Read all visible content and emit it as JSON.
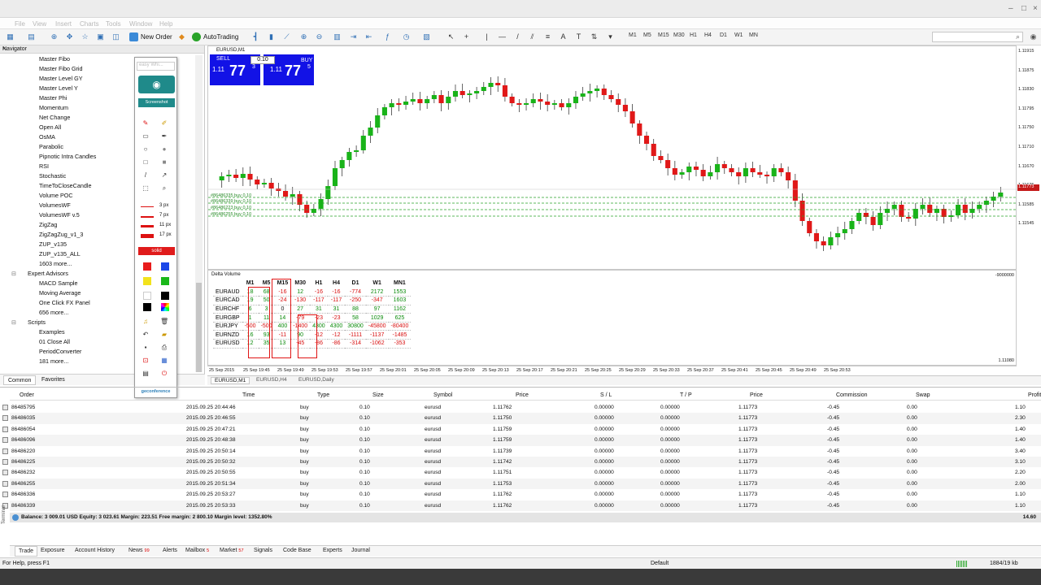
{
  "menu": {
    "items": [
      "File",
      "View",
      "Insert",
      "Charts",
      "Tools",
      "Window",
      "Help"
    ]
  },
  "toolbar": {
    "new_order": "New Order",
    "autotrading": "AutoTrading",
    "timeframes": [
      "M1",
      "M5",
      "M15",
      "M30",
      "H1",
      "H4",
      "D1",
      "W1",
      "MN"
    ]
  },
  "navigator": {
    "title": "Navigator",
    "items": [
      {
        "label": "Master Fibo",
        "indent": 1
      },
      {
        "label": "Master Fibo Grid",
        "indent": 1
      },
      {
        "label": "Master Level GY",
        "indent": 1
      },
      {
        "label": "Master Level Y",
        "indent": 1
      },
      {
        "label": "Master Phi",
        "indent": 1
      },
      {
        "label": "Momentum",
        "indent": 1
      },
      {
        "label": "Net Change",
        "indent": 1
      },
      {
        "label": "Open All",
        "indent": 1
      },
      {
        "label": "OsMA",
        "indent": 1
      },
      {
        "label": "Parabolic",
        "indent": 1
      },
      {
        "label": "Pipnotic Intra Candles",
        "indent": 1
      },
      {
        "label": "RSI",
        "indent": 1
      },
      {
        "label": "Stochastic",
        "indent": 1
      },
      {
        "label": "TimeToCloseCandle",
        "indent": 1
      },
      {
        "label": "Volume POC",
        "indent": 1
      },
      {
        "label": "VolumesWF",
        "indent": 1
      },
      {
        "label": "VolumesWF v.5",
        "indent": 1
      },
      {
        "label": "ZigZag",
        "indent": 1
      },
      {
        "label": "ZigZagZug_v1_3",
        "indent": 1
      },
      {
        "label": "ZUP_v135",
        "indent": 1
      },
      {
        "label": "ZUP_v135_ALL",
        "indent": 1
      },
      {
        "label": "1603 more...",
        "indent": 1
      },
      {
        "label": "Expert Advisors",
        "indent": 0
      },
      {
        "label": "MACD Sample",
        "indent": 1
      },
      {
        "label": "Moving Average",
        "indent": 1
      },
      {
        "label": "One Click FX Panel",
        "indent": 1
      },
      {
        "label": "656 more...",
        "indent": 1
      },
      {
        "label": "Scripts",
        "indent": 0
      },
      {
        "label": "Examples",
        "indent": 1
      },
      {
        "label": "01 Close All",
        "indent": 1
      },
      {
        "label": "PeriodConverter",
        "indent": 1
      },
      {
        "label": "181 more...",
        "indent": 1
      }
    ],
    "tabs": [
      "Common",
      "Favorites"
    ]
  },
  "palette": {
    "search_placeholder": "easy Whi...",
    "screenshot": "Screenshot",
    "widths": [
      "3 px",
      "7 px",
      "11 px",
      "17 px"
    ],
    "solid": "solid",
    "brand": "geconference",
    "colors": [
      "#e81c1c",
      "#1c48e8",
      "#f2e21c",
      "#1ab81a",
      "#ffffff",
      "#000000"
    ]
  },
  "chart": {
    "window_title": "EURUSD,M1",
    "trade": {
      "sell": "SELL",
      "buy": "BUY",
      "lot": "0.10",
      "sell_small": "1.11",
      "sell_big": "77",
      "sell_sup": "3",
      "buy_small": "1.11",
      "buy_big": "77",
      "buy_sup": "5"
    },
    "current_price": "1.11773",
    "price_labels": [
      "1.11915",
      "1.11875",
      "1.11830",
      "1.11795",
      "1.11750",
      "1.11710",
      "1.11670",
      "1.11625",
      "1.11585",
      "1.11545"
    ],
    "line_labels": [
      "#86486335 buy 0.10",
      "#86486339 buy 0.10",
      "#86486223 buy 0.10",
      "#86486255 buy 0.10"
    ],
    "x_labels": [
      "25 Sep 2015",
      "25 Sep 19:45",
      "25 Sep 19:49",
      "25 Sep 19:53",
      "25 Sep 19:57",
      "25 Sep 20:01",
      "25 Sep 20:05",
      "25 Sep 20:09",
      "25 Sep 20:13",
      "25 Sep 20:17",
      "25 Sep 20:21",
      "25 Sep 20:25",
      "25 Sep 20:29",
      "25 Sep 20:33",
      "25 Sep 20:37",
      "25 Sep 20:41",
      "25 Sep 20:45",
      "25 Sep 20:49",
      "25 Sep 20:53"
    ],
    "lower_labels": [
      "-9000000",
      "1.11080"
    ],
    "tabs": [
      "EURUSD,M1",
      "EURUSD,H4",
      "EURUSD,Daily"
    ]
  },
  "chart_data": {
    "type": "table",
    "title": "Delta Volume",
    "columns": [
      "",
      "M1",
      "M5",
      "M15",
      "M30",
      "H1",
      "H4",
      "D1",
      "W1",
      "MN1"
    ],
    "rows": [
      [
        "EURAUD",
        "18",
        "68",
        "-16",
        "12",
        "-16",
        "-16",
        "-774",
        "2172",
        "1553"
      ],
      [
        "EURCAD",
        "19",
        "50",
        "-24",
        "-130",
        "-117",
        "-117",
        "-250",
        "-347",
        "1603"
      ],
      [
        "EURCHF",
        "6",
        "3",
        "0",
        "27",
        "31",
        "31",
        "88",
        "97",
        "1162"
      ],
      [
        "EURGBP",
        "1",
        "11",
        "14",
        "-79",
        "-23",
        "-23",
        "58",
        "1029",
        "625"
      ],
      [
        "EURJPY",
        "-500",
        "-500",
        "400",
        "-1400",
        "4300",
        "4300",
        "30800",
        "-45800",
        "-80400"
      ],
      [
        "EURNZD",
        "16",
        "93",
        "-11",
        "90",
        "-12",
        "-12",
        "-1111",
        "-1137",
        "-1485"
      ],
      [
        "EURUSD",
        "12",
        "35",
        "13",
        "-45",
        "-86",
        "-86",
        "-314",
        "-1062",
        "-353"
      ]
    ]
  },
  "terminal": {
    "headers": [
      "Order",
      "Time",
      "Type",
      "Size",
      "Symbol",
      "Price",
      "S / L",
      "T / P",
      "Price",
      "Commission",
      "Swap",
      "Profit"
    ],
    "orders": [
      [
        "86485795",
        "2015.09.25 20:44:46",
        "buy",
        "0.10",
        "eurusd",
        "1.11762",
        "0.00000",
        "0.00000",
        "1.11773",
        "-0.45",
        "0.00",
        "1.10"
      ],
      [
        "86486035",
        "2015.09.25 20:46:55",
        "buy",
        "0.10",
        "eurusd",
        "1.11750",
        "0.00000",
        "0.00000",
        "1.11773",
        "-0.45",
        "0.00",
        "2.30"
      ],
      [
        "86486054",
        "2015.09.25 20:47:21",
        "buy",
        "0.10",
        "eurusd",
        "1.11759",
        "0.00000",
        "0.00000",
        "1.11773",
        "-0.45",
        "0.00",
        "1.40"
      ],
      [
        "86486096",
        "2015.09.25 20:48:38",
        "buy",
        "0.10",
        "eurusd",
        "1.11759",
        "0.00000",
        "0.00000",
        "1.11773",
        "-0.45",
        "0.00",
        "1.40"
      ],
      [
        "86486220",
        "2015.09.25 20:50:14",
        "buy",
        "0.10",
        "eurusd",
        "1.11739",
        "0.00000",
        "0.00000",
        "1.11773",
        "-0.45",
        "0.00",
        "3.40"
      ],
      [
        "86486225",
        "2015.09.25 20:50:32",
        "buy",
        "0.10",
        "eurusd",
        "1.11742",
        "0.00000",
        "0.00000",
        "1.11773",
        "-0.45",
        "0.00",
        "3.10"
      ],
      [
        "86486232",
        "2015.09.25 20:50:55",
        "buy",
        "0.10",
        "eurusd",
        "1.11751",
        "0.00000",
        "0.00000",
        "1.11773",
        "-0.45",
        "0.00",
        "2.20"
      ],
      [
        "86486255",
        "2015.09.25 20:51:34",
        "buy",
        "0.10",
        "eurusd",
        "1.11753",
        "0.00000",
        "0.00000",
        "1.11773",
        "-0.45",
        "0.00",
        "2.00"
      ],
      [
        "86486336",
        "2015.09.25 20:53:27",
        "buy",
        "0.10",
        "eurusd",
        "1.11762",
        "0.00000",
        "0.00000",
        "1.11773",
        "-0.45",
        "0.00",
        "1.10"
      ],
      [
        "86486339",
        "2015.09.25 20:53:33",
        "buy",
        "0.10",
        "eurusd",
        "1.11762",
        "0.00000",
        "0.00000",
        "1.11773",
        "-0.45",
        "0.00",
        "1.10"
      ]
    ],
    "balance": "Balance: 3 009.01 USD  Equity: 3 023.61  Margin: 223.51  Free margin: 2 800.10  Margin level: 1352.80%",
    "total_profit": "14.60",
    "tabs": [
      {
        "label": "Trade",
        "count": ""
      },
      {
        "label": "Exposure",
        "count": ""
      },
      {
        "label": "Account History",
        "count": ""
      },
      {
        "label": "News",
        "count": "99"
      },
      {
        "label": "Alerts",
        "count": ""
      },
      {
        "label": "Mailbox",
        "count": "5"
      },
      {
        "label": "Market",
        "count": "57"
      },
      {
        "label": "Signals",
        "count": ""
      },
      {
        "label": "Code Base",
        "count": ""
      },
      {
        "label": "Experts",
        "count": ""
      },
      {
        "label": "Journal",
        "count": ""
      }
    ],
    "side_title": "Terminal"
  },
  "status": {
    "help": "For Help, press F1",
    "profile": "Default",
    "traffic": "1884/19 kb"
  }
}
